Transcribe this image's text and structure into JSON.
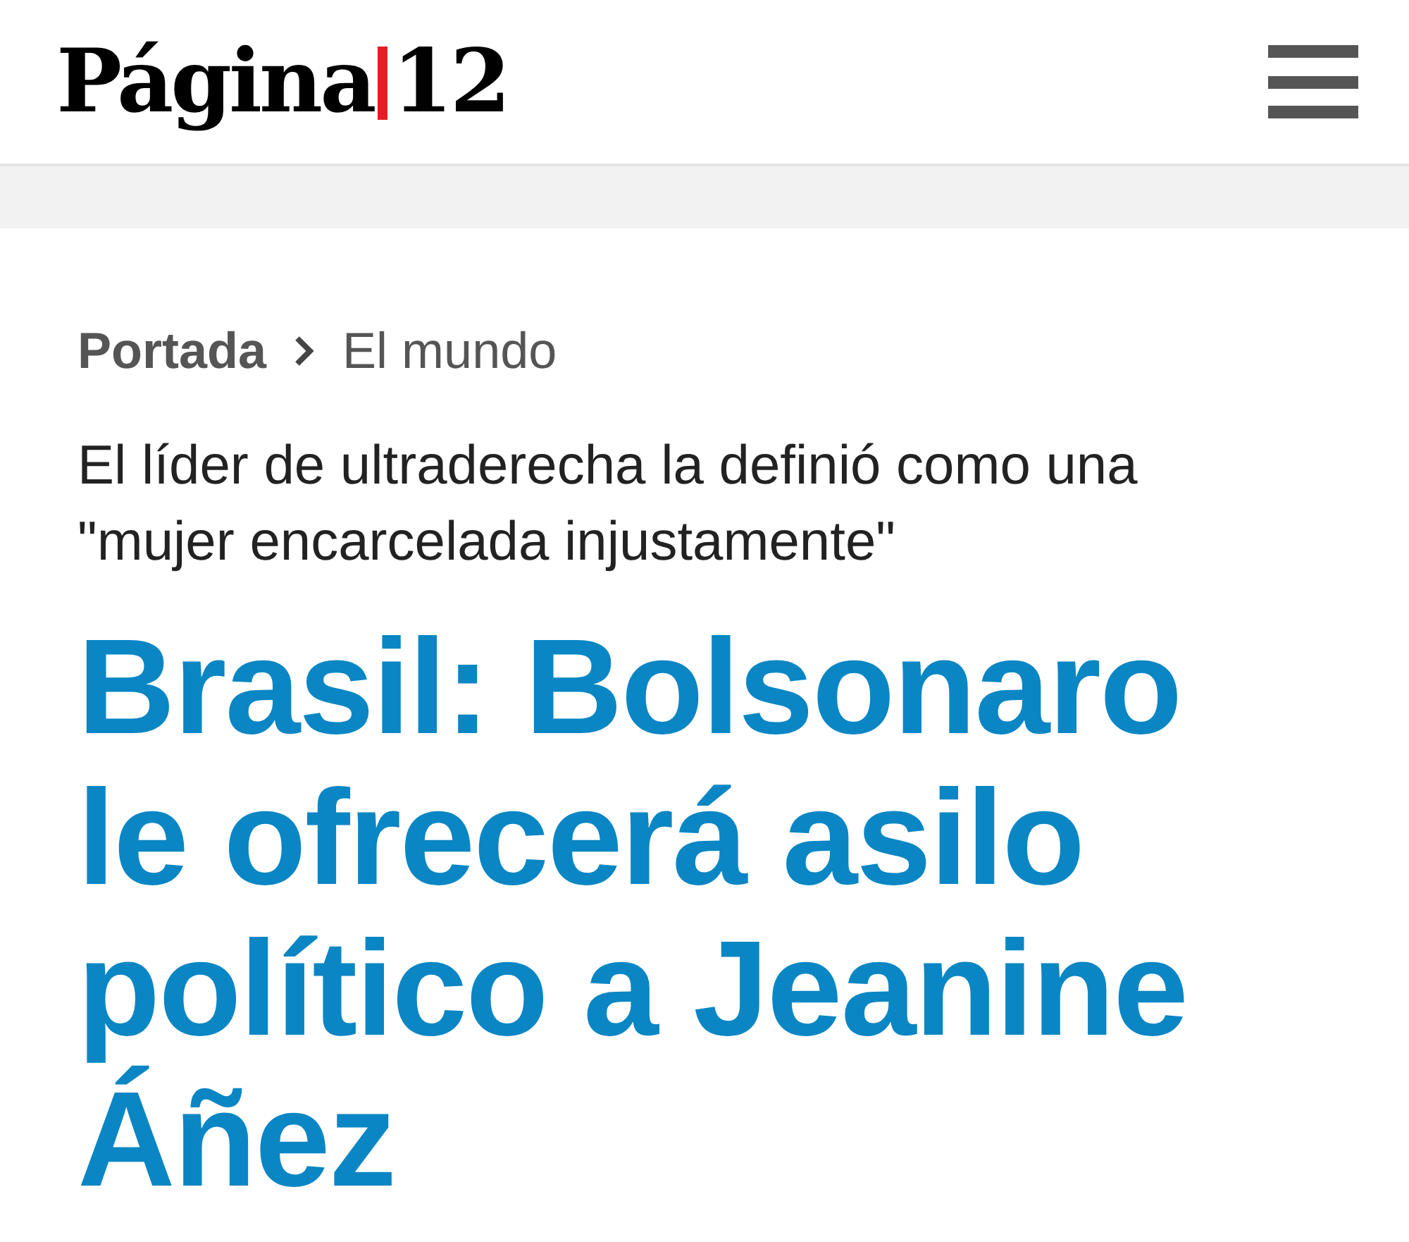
{
  "header": {
    "logo": {
      "name": "Página",
      "number": "12"
    }
  },
  "breadcrumb": [
    {
      "label": "Portada",
      "current": false
    },
    {
      "label": "El mundo",
      "current": true
    }
  ],
  "article": {
    "kicker": "El líder de ultraderecha la definió como una \"mujer encarcelada injustamente\"",
    "headline": "Brasil: Bolsonaro le ofrecerá asilo político a Jeanine Áñez"
  }
}
